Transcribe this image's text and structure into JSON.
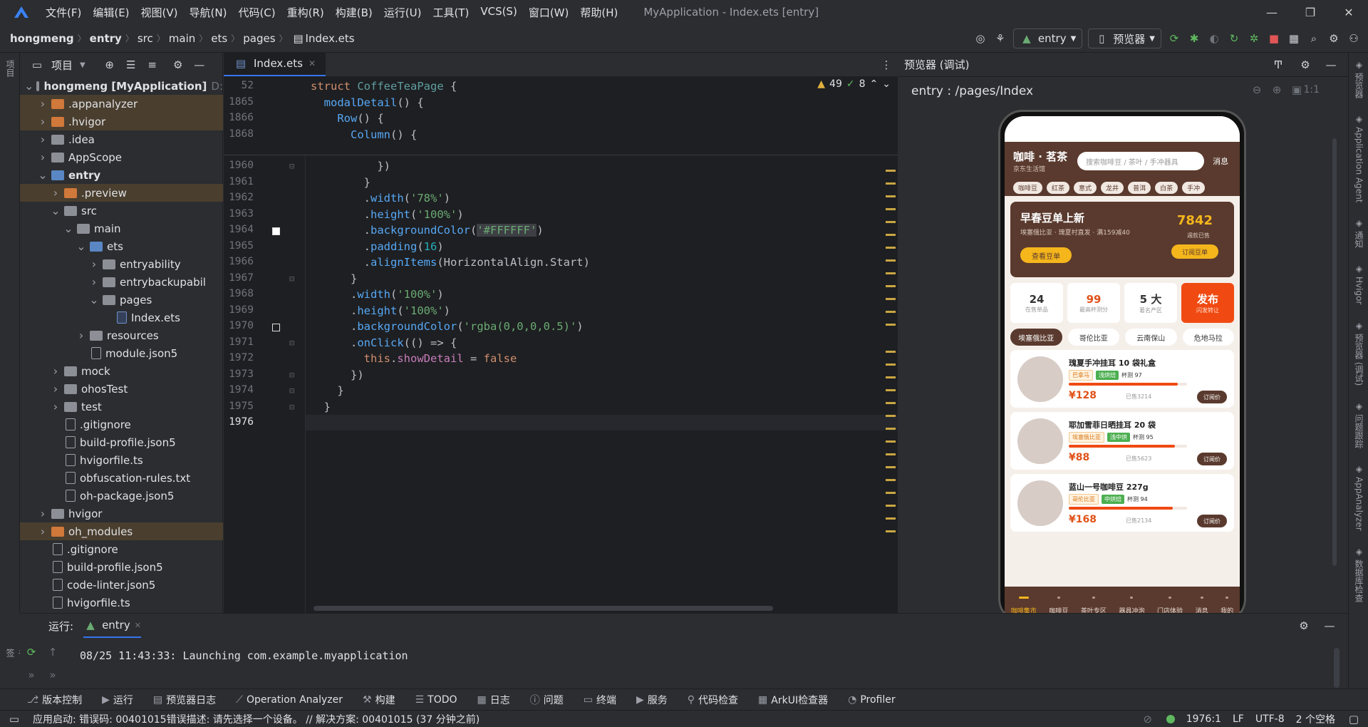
{
  "menubar": {
    "items": [
      "文件(F)",
      "编辑(E)",
      "视图(V)",
      "导航(N)",
      "代码(C)",
      "重构(R)",
      "构建(B)",
      "运行(U)",
      "工具(T)",
      "VCS(S)",
      "窗口(W)",
      "帮助(H)"
    ],
    "title": "MyApplication - Index.ets [entry]"
  },
  "breadcrumb": [
    "hongmeng",
    "entry",
    "src",
    "main",
    "ets",
    "pages",
    "Index.ets"
  ],
  "toolbar": {
    "run_config": "entry",
    "device": "预览器"
  },
  "project": {
    "header": "项目",
    "tree": [
      {
        "label": "hongmeng [MyApplication]",
        "suffix": "D:",
        "depth": 0,
        "arrow": "down",
        "type": "folder-gray",
        "bold_part": "[MyApplication]"
      },
      {
        "label": ".appanalyzer",
        "depth": 1,
        "arrow": "right",
        "type": "folder-orange",
        "hl": true
      },
      {
        "label": ".hvigor",
        "depth": 1,
        "arrow": "right",
        "type": "folder-orange",
        "hl": true
      },
      {
        "label": ".idea",
        "depth": 1,
        "arrow": "right",
        "type": "folder-gray"
      },
      {
        "label": "AppScope",
        "depth": 1,
        "arrow": "right",
        "type": "folder-gray"
      },
      {
        "label": "entry",
        "depth": 1,
        "arrow": "down",
        "type": "folder-blue",
        "bold": true
      },
      {
        "label": ".preview",
        "depth": 2,
        "arrow": "right",
        "type": "folder-orange",
        "hl": true
      },
      {
        "label": "src",
        "depth": 2,
        "arrow": "down",
        "type": "folder-gray"
      },
      {
        "label": "main",
        "depth": 3,
        "arrow": "down",
        "type": "folder-gray"
      },
      {
        "label": "ets",
        "depth": 4,
        "arrow": "down",
        "type": "folder-blue"
      },
      {
        "label": "entryability",
        "depth": 5,
        "arrow": "right",
        "type": "folder-gray"
      },
      {
        "label": "entrybackupabil",
        "depth": 5,
        "arrow": "right",
        "type": "folder-gray"
      },
      {
        "label": "pages",
        "depth": 5,
        "arrow": "down",
        "type": "folder-gray"
      },
      {
        "label": "Index.ets",
        "depth": 6,
        "arrow": "",
        "type": "file-ets"
      },
      {
        "label": "resources",
        "depth": 4,
        "arrow": "right",
        "type": "folder-gray"
      },
      {
        "label": "module.json5",
        "depth": 4,
        "arrow": "",
        "type": "file"
      },
      {
        "label": "mock",
        "depth": 2,
        "arrow": "right",
        "type": "folder-gray"
      },
      {
        "label": "ohosTest",
        "depth": 2,
        "arrow": "right",
        "type": "folder-gray"
      },
      {
        "label": "test",
        "depth": 2,
        "arrow": "right",
        "type": "folder-gray"
      },
      {
        "label": ".gitignore",
        "depth": 2,
        "arrow": "",
        "type": "file"
      },
      {
        "label": "build-profile.json5",
        "depth": 2,
        "arrow": "",
        "type": "file"
      },
      {
        "label": "hvigorfile.ts",
        "depth": 2,
        "arrow": "",
        "type": "file"
      },
      {
        "label": "obfuscation-rules.txt",
        "depth": 2,
        "arrow": "",
        "type": "file"
      },
      {
        "label": "oh-package.json5",
        "depth": 2,
        "arrow": "",
        "type": "file"
      },
      {
        "label": "hvigor",
        "depth": 1,
        "arrow": "right",
        "type": "folder-gray"
      },
      {
        "label": "oh_modules",
        "depth": 1,
        "arrow": "right",
        "type": "folder-orange",
        "hl": true
      },
      {
        "label": ".gitignore",
        "depth": 1,
        "arrow": "",
        "type": "file"
      },
      {
        "label": "build-profile.json5",
        "depth": 1,
        "arrow": "",
        "type": "file"
      },
      {
        "label": "code-linter.json5",
        "depth": 1,
        "arrow": "",
        "type": "file"
      },
      {
        "label": "hvigorfile.ts",
        "depth": 1,
        "arrow": "",
        "type": "file"
      }
    ]
  },
  "editor": {
    "tab": "Index.ets",
    "warnings": "49",
    "weak": "8",
    "sticky": [
      {
        "ln": "52",
        "html": "<span class='kw'>struct</span> <span class='ty' style='color:#5f9ea0'>CoffeeTeaPage</span> {"
      },
      {
        "ln": "1865",
        "html": "  <span class='fn'>modalDetail</span>() {"
      },
      {
        "ln": "1866",
        "html": "    <span class='fn'>Row</span>() {"
      },
      {
        "ln": "1868",
        "html": "      <span class='fn'>Column</span>() {"
      }
    ],
    "lines": [
      {
        "ln": "1960",
        "html": "          })"
      },
      {
        "ln": "1961",
        "html": "        }"
      },
      {
        "ln": "1962",
        "html": "        .<span class='fn'>width</span>(<span class='st'>'78%'</span>)"
      },
      {
        "ln": "1963",
        "html": "        .<span class='fn'>height</span>(<span class='st'>'100%'</span>)"
      },
      {
        "ln": "1964",
        "html": "        .<span class='fn'>backgroundColor</span>(<span class='st' style='background:#3d3f44'>'#FFFFFF'</span>)"
      },
      {
        "ln": "1965",
        "html": "        .<span class='fn'>padding</span>(<span class='nm'>16</span>)"
      },
      {
        "ln": "1966",
        "html": "        .<span class='fn'>alignItems</span>(HorizontalAlign.Start)"
      },
      {
        "ln": "1967",
        "html": "      }"
      },
      {
        "ln": "1968",
        "html": "      .<span class='fn'>width</span>(<span class='st'>'100%'</span>)"
      },
      {
        "ln": "1969",
        "html": "      .<span class='fn'>height</span>(<span class='st'>'100%'</span>)"
      },
      {
        "ln": "1970",
        "html": "      .<span class='fn'>backgroundColor</span>(<span class='st'>'rgba(0,0,0,0.5)'</span>)"
      },
      {
        "ln": "1971",
        "html": "      .<span class='fn'>onClick</span>(() => {"
      },
      {
        "ln": "1972",
        "html": "        <span class='kw'>this</span>.<span class='pr'>showDetail</span> = <span class='kw'>false</span>"
      },
      {
        "ln": "1973",
        "html": "      })"
      },
      {
        "ln": "1974",
        "html": "    }"
      },
      {
        "ln": "1975",
        "html": "  }"
      },
      {
        "ln": "1976",
        "html": ""
      }
    ]
  },
  "previewer": {
    "header": "预览器 (调试)",
    "path": "entry : /pages/Index",
    "app": {
      "brand": "咖啡 · 茗茶",
      "brand_sub": "京东生活馆",
      "search_ph": "搜索咖啡豆 / 茶叶 / 手冲器具",
      "msg": "消息",
      "chips": [
        "咖啡豆",
        "红茶",
        "意式",
        "龙井",
        "普洱",
        "白茶",
        "手冲"
      ],
      "banner": {
        "title": "早春豆单上新",
        "sub": "埃塞俄比亚 · 瑰夏村直发 · 满159减40",
        "btn": "查看豆单",
        "num": "7842",
        "num_label": "週款已售",
        "btn2": "订阅豆单"
      },
      "stats": [
        {
          "v": "24",
          "l": "在售单品"
        },
        {
          "v": "99",
          "l": "最高杯测分"
        },
        {
          "v": "5 大",
          "l": "著名产区"
        },
        {
          "v": "发布",
          "l": "闪发转让"
        }
      ],
      "origins": [
        "埃塞俄比亚",
        "哥伦比亚",
        "云南保山",
        "危地马拉"
      ],
      "products": [
        {
          "name": "瑰夏手冲挂耳 10 袋礼盒",
          "tag1": "巴拿马",
          "tag2": "浅烘焙",
          "cup": "杯测 97",
          "price": "¥128",
          "sold": "已售3214",
          "btn": "订阅价",
          "bar": 92
        },
        {
          "name": "耶加雪菲日晒挂耳 20 袋",
          "tag1": "埃塞俄比亚",
          "tag2": "浅中烘",
          "cup": "杯测 95",
          "price": "¥88",
          "sold": "已售5623",
          "btn": "订阅价",
          "bar": 90
        },
        {
          "name": "蓝山一号咖啡豆 227g",
          "tag1": "哥伦比亚",
          "tag2": "中烘焙",
          "cup": "杯测 94",
          "price": "¥168",
          "sold": "已售2134",
          "btn": "订阅价",
          "bar": 88
        }
      ],
      "tabbar": [
        "咖啡集市",
        "咖啡豆",
        "茶叶专区",
        "器具冲泡",
        "门店体验",
        "消息",
        "我的"
      ]
    }
  },
  "runpanel": {
    "label": "运行:",
    "tab": "entry",
    "log": "08/25 11:43:33: Launching com.example.myapplication"
  },
  "bottomtools": [
    "版本控制",
    "运行",
    "预览器日志",
    "Operation Analyzer",
    "构建",
    "TODO",
    "日志",
    "问题",
    "终端",
    "服务",
    "代码检查",
    "ArkUI检查器",
    "Profiler"
  ],
  "status": {
    "msg": "应用启动: 错误码: 00401015错误描述: 请先选择一个设备。 // 解决方案: 00401015 (37 分钟之前)",
    "pos": "1976:1",
    "eol": "LF",
    "enc": "UTF-8",
    "indent": "2 个空格"
  },
  "side": {
    "left": [
      "项目",
      "书签",
      "结构"
    ],
    "right": [
      "预览器",
      "Application Agent",
      "通知",
      "Hvigor",
      "预览器 (调试)",
      "问题跟踪",
      "AppAnalyzer",
      "数据库检查"
    ]
  }
}
